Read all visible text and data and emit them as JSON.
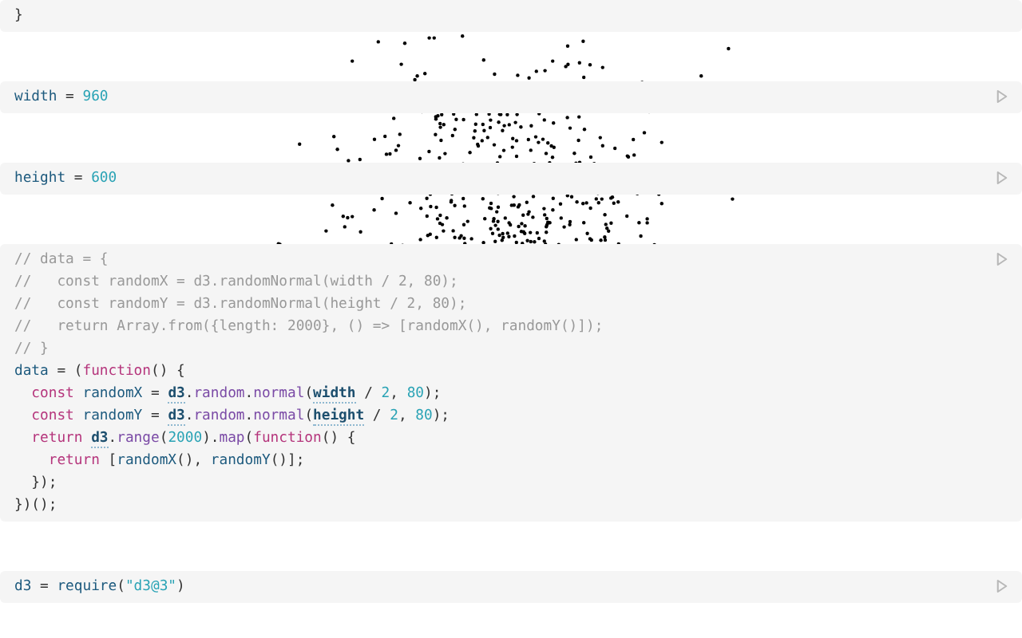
{
  "cells": [
    {
      "run_button": false,
      "lines": [
        [
          {
            "kind": "plain",
            "text": "}"
          }
        ]
      ]
    },
    {
      "run_button": true,
      "lines": [
        [
          {
            "kind": "name",
            "text": "width"
          },
          {
            "kind": "plain",
            "text": " = "
          },
          {
            "kind": "number",
            "text": "960"
          }
        ]
      ]
    },
    {
      "run_button": true,
      "lines": [
        [
          {
            "kind": "name",
            "text": "height"
          },
          {
            "kind": "plain",
            "text": " = "
          },
          {
            "kind": "number",
            "text": "600"
          }
        ]
      ]
    },
    {
      "run_button": true,
      "lines": [
        [
          {
            "kind": "comment",
            "text": "// data = {"
          }
        ],
        [
          {
            "kind": "comment",
            "text": "//   const randomX = d3.randomNormal(width / 2, 80);"
          }
        ],
        [
          {
            "kind": "comment",
            "text": "//   const randomY = d3.randomNormal(height / 2, 80);"
          }
        ],
        [
          {
            "kind": "comment",
            "text": "//   return Array.from({length: 2000}, () => [randomX(), randomY()]);"
          }
        ],
        [
          {
            "kind": "comment",
            "text": "// }"
          }
        ],
        [
          {
            "kind": "name",
            "text": "data"
          },
          {
            "kind": "plain",
            "text": " = ("
          },
          {
            "kind": "keyword",
            "text": "function"
          },
          {
            "kind": "plain",
            "text": "() {"
          }
        ],
        [
          {
            "kind": "keyword",
            "text": "  const"
          },
          {
            "kind": "name",
            "text": " randomX"
          },
          {
            "kind": "plain",
            "text": " = "
          },
          {
            "kind": "ref",
            "text": "d3"
          },
          {
            "kind": "plain",
            "text": "."
          },
          {
            "kind": "method",
            "text": "random"
          },
          {
            "kind": "plain",
            "text": "."
          },
          {
            "kind": "method",
            "text": "normal"
          },
          {
            "kind": "plain",
            "text": "("
          },
          {
            "kind": "ref",
            "text": "width"
          },
          {
            "kind": "plain",
            "text": " / "
          },
          {
            "kind": "number",
            "text": "2"
          },
          {
            "kind": "plain",
            "text": ", "
          },
          {
            "kind": "number",
            "text": "80"
          },
          {
            "kind": "plain",
            "text": ");"
          }
        ],
        [
          {
            "kind": "keyword",
            "text": "  const"
          },
          {
            "kind": "name",
            "text": " randomY"
          },
          {
            "kind": "plain",
            "text": " = "
          },
          {
            "kind": "ref",
            "text": "d3"
          },
          {
            "kind": "plain",
            "text": "."
          },
          {
            "kind": "method",
            "text": "random"
          },
          {
            "kind": "plain",
            "text": "."
          },
          {
            "kind": "method",
            "text": "normal"
          },
          {
            "kind": "plain",
            "text": "("
          },
          {
            "kind": "ref",
            "text": "height"
          },
          {
            "kind": "plain",
            "text": " / "
          },
          {
            "kind": "number",
            "text": "2"
          },
          {
            "kind": "plain",
            "text": ", "
          },
          {
            "kind": "number",
            "text": "80"
          },
          {
            "kind": "plain",
            "text": ");"
          }
        ],
        [
          {
            "kind": "keyword",
            "text": "  return "
          },
          {
            "kind": "ref",
            "text": "d3"
          },
          {
            "kind": "plain",
            "text": "."
          },
          {
            "kind": "method",
            "text": "range"
          },
          {
            "kind": "plain",
            "text": "("
          },
          {
            "kind": "number",
            "text": "2000"
          },
          {
            "kind": "plain",
            "text": ")."
          },
          {
            "kind": "method",
            "text": "map"
          },
          {
            "kind": "plain",
            "text": "("
          },
          {
            "kind": "keyword",
            "text": "function"
          },
          {
            "kind": "plain",
            "text": "() {"
          }
        ],
        [
          {
            "kind": "keyword",
            "text": "    return"
          },
          {
            "kind": "plain",
            "text": " ["
          },
          {
            "kind": "name",
            "text": "randomX"
          },
          {
            "kind": "plain",
            "text": "(), "
          },
          {
            "kind": "name",
            "text": "randomY"
          },
          {
            "kind": "plain",
            "text": "()];"
          }
        ],
        [
          {
            "kind": "plain",
            "text": "  });"
          }
        ],
        [
          {
            "kind": "plain",
            "text": "})();"
          }
        ]
      ]
    },
    {
      "run_button": true,
      "lines": [
        [
          {
            "kind": "name",
            "text": "d3"
          },
          {
            "kind": "plain",
            "text": " = "
          },
          {
            "kind": "name",
            "text": "require"
          },
          {
            "kind": "plain",
            "text": "("
          },
          {
            "kind": "string",
            "text": "\"d3@3\""
          },
          {
            "kind": "plain",
            "text": ")"
          }
        ]
      ]
    }
  ]
}
